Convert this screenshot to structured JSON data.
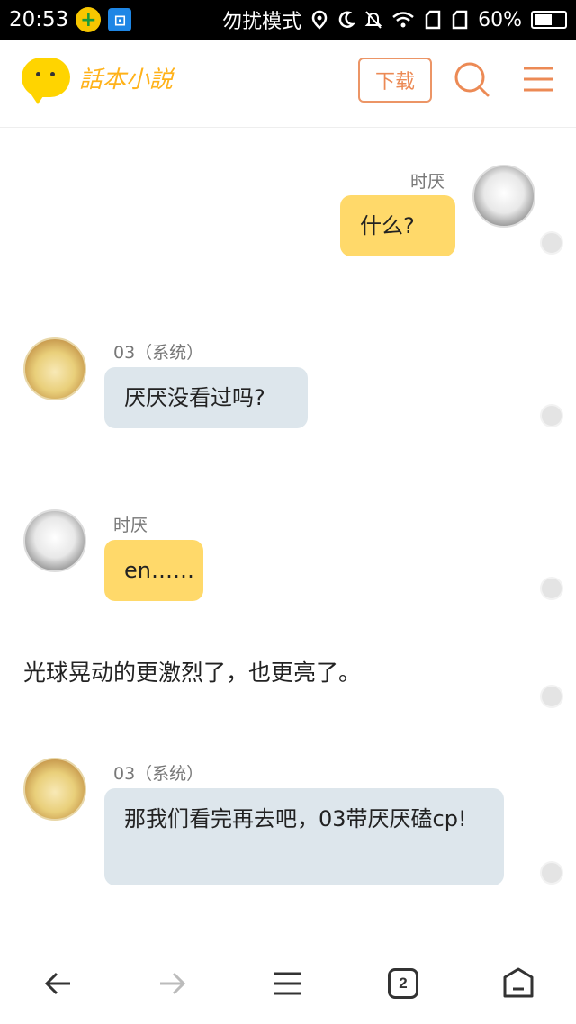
{
  "status_bar": {
    "time": "20:53",
    "dnd_label": "勿扰模式",
    "battery": "60%",
    "battery_level": 0.6,
    "icons": [
      "app-plus-icon",
      "screenshot-icon",
      "location-icon",
      "moon-icon",
      "bell-off-icon",
      "wifi-icon",
      "sim1-icon",
      "sim2-icon",
      "battery-icon"
    ]
  },
  "header": {
    "logo_text": "話本小説",
    "download_label": "下载",
    "accent": "#ec8a55"
  },
  "messages": [
    {
      "sender": "时厌",
      "text": "什么?",
      "side": "right",
      "style": "yellow"
    },
    {
      "sender": "03（系统）",
      "text": "厌厌没看过吗?",
      "side": "left",
      "style": "blue"
    },
    {
      "sender": "时厌",
      "text": "en……",
      "side": "left",
      "style": "yellow"
    },
    {
      "sender": "03（系统）",
      "text": "那我们看完再去吧，03带厌厌磕cp!",
      "side": "left",
      "style": "blue"
    }
  ],
  "narration": "光球晃动的更激烈了，也更亮了。",
  "bottom_nav": {
    "tab_count": "2",
    "items": [
      "back-icon",
      "forward-icon",
      "menu-icon",
      "tabs-icon",
      "home-icon"
    ]
  },
  "colors": {
    "yellow_bubble": "#ffd96a",
    "blue_bubble": "#dde6ec",
    "logo_yellow": "#ffd400"
  }
}
